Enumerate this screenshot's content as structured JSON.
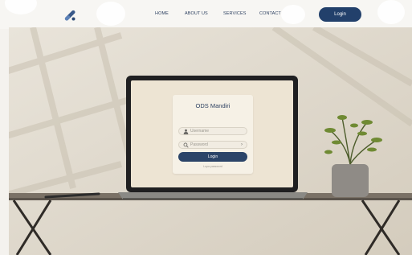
{
  "nav": {
    "items": [
      "HOME",
      "ABOUT US",
      "SERVICES",
      "CONTACT"
    ],
    "login_label": "Login",
    "accent": "#22406b"
  },
  "login_card": {
    "title": "ODS Mandiri",
    "username_placeholder": "Username",
    "password_placeholder": "Password",
    "login_label": "Login",
    "forgot_label": "Lupa password",
    "icons": [
      "user-icon",
      "search-icon",
      "chevron-right-icon"
    ]
  }
}
